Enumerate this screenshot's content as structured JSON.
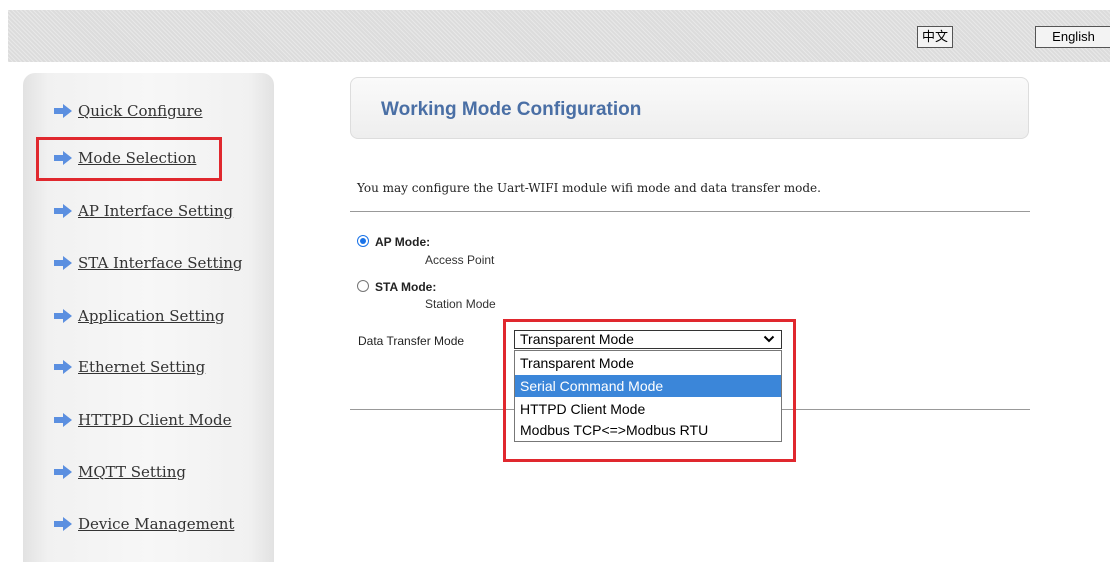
{
  "header": {
    "lang_zh": "中文",
    "lang_en": "English"
  },
  "sidebar": {
    "items": [
      {
        "label": "Quick Configure"
      },
      {
        "label": "Mode Selection"
      },
      {
        "label": "AP Interface Setting"
      },
      {
        "label": "STA Interface Setting"
      },
      {
        "label": "Application Setting"
      },
      {
        "label": "Ethernet Setting"
      },
      {
        "label": "HTTPD Client Mode"
      },
      {
        "label": "MQTT Setting"
      },
      {
        "label": "Device Management"
      }
    ],
    "highlighted_item": "Mode Selection"
  },
  "main": {
    "title": "Working Mode Configuration",
    "description": "You may configure the Uart-WIFI module wifi mode and data transfer mode.",
    "modes": [
      {
        "label": "AP Mode:",
        "sub": "Access Point",
        "checked": true
      },
      {
        "label": "STA Mode:",
        "sub": "Station Mode",
        "checked": false
      }
    ],
    "transfer": {
      "label": "Data Transfer Mode",
      "selected": "Transparent Mode",
      "options": [
        "Transparent Mode",
        "Serial Command Mode",
        "HTTPD Client Mode",
        "Modbus TCP<=>Modbus RTU"
      ],
      "hovered_option": "Serial Command Mode"
    }
  },
  "colors": {
    "title": "#4a6fa5",
    "highlight_border": "#e0282e",
    "option_hover": "#3b86d9",
    "nav_arrow": "#5b8fe0"
  },
  "icons": {
    "nav": "arrow-right-icon",
    "select": "chevron-down-icon"
  }
}
